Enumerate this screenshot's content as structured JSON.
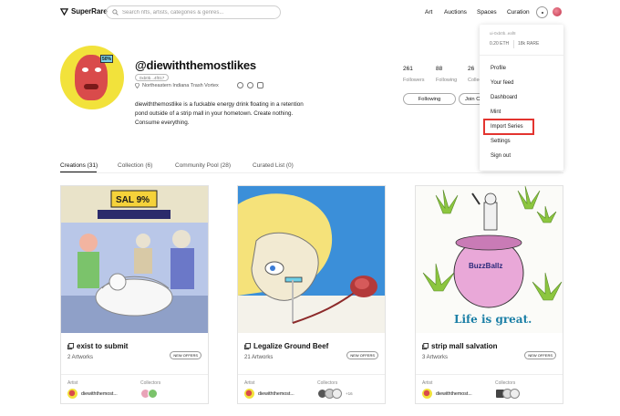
{
  "nav": {
    "logo": "SuperRare",
    "search_placeholder": "Search nfts, artists, categories & genres...",
    "links": [
      "Art",
      "Auctions",
      "Spaces",
      "Curation"
    ]
  },
  "profile": {
    "username": "@diewiththemostlikes",
    "wallet": "0xb0b...4f017",
    "location": "Northeastern Indiana Trash Vortex",
    "bio": "diewiththemostlike is a fuckable energy drink floating in a retention pond outside of a strip mall in your hometown. Create nothing. Consume everything.",
    "stats": [
      {
        "value": "261",
        "label": "Followers"
      },
      {
        "value": "88",
        "label": "Following"
      },
      {
        "value": "26",
        "label": "Collec"
      }
    ],
    "following_button": "Following",
    "join_button": "Join Co"
  },
  "menu": {
    "wallet": "ui-0xb0b..eaf8",
    "balance_eth": "0.20 ETH",
    "balance_rare": "18k RARE",
    "items": [
      "Profile",
      "Your feed",
      "Dashboard",
      "Mint",
      "Import Series",
      "Settings",
      "Sign out"
    ]
  },
  "tabs": [
    "Creations (31)",
    "Collection (6)",
    "Community Pool (28)",
    "Curated List (0)"
  ],
  "cards": [
    {
      "title": "exist to submit",
      "badge": "NEW OFFERS",
      "count": "2 Artworks",
      "artist_label": "Artist",
      "collectors_label": "Collectors",
      "artist": "diewiththemost...",
      "collectors_extra": ""
    },
    {
      "title": "Legalize Ground Beef",
      "badge": "NEW OFFERS",
      "count": "21 Artworks",
      "artist_label": "Artist",
      "collectors_label": "Collectors",
      "artist": "diewiththemost...",
      "collectors_extra": "+16"
    },
    {
      "title": "strip mall salvation",
      "badge": "NEW OFFERS",
      "count": "3 Artworks",
      "artist_label": "Artist",
      "collectors_label": "Collectors",
      "artist": "diewiththemost...",
      "collectors_extra": ""
    }
  ],
  "artwork_text": {
    "card1_sign": "SAL 9%",
    "card3_can": "BuzzBallz",
    "card3_caption": "Life is great."
  },
  "colors": {
    "highlight": "#e3342f",
    "avatar_bg": "#f2e23b",
    "card2_bg": "#3b8fd9"
  }
}
